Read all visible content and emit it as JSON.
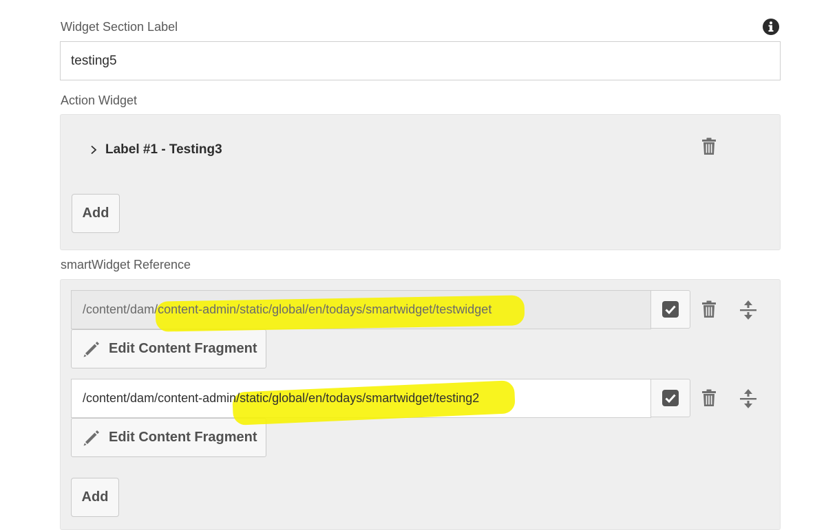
{
  "section": {
    "label": "Widget Section Label",
    "value": "testing5",
    "info_icon": "info-icon"
  },
  "action_widget": {
    "label": "Action Widget",
    "items": [
      {
        "label": "Label #1 - Testing3"
      }
    ],
    "add_label": "Add"
  },
  "smart_widget": {
    "label": "smartWidget Reference",
    "references": [
      {
        "path": "/content/dam/content-admin/static/global/en/todays/smartwidget/testwidget",
        "edit_label": "Edit Content Fragment"
      },
      {
        "path": "/content/dam/content-admin/static/global/en/todays/smartwidget/testing2",
        "edit_label": "Edit Content Fragment"
      }
    ],
    "add_label": "Add"
  },
  "colors": {
    "highlight": "#f7f200",
    "panel_bg": "#efefef",
    "icon_gray": "#6e6e6e"
  }
}
